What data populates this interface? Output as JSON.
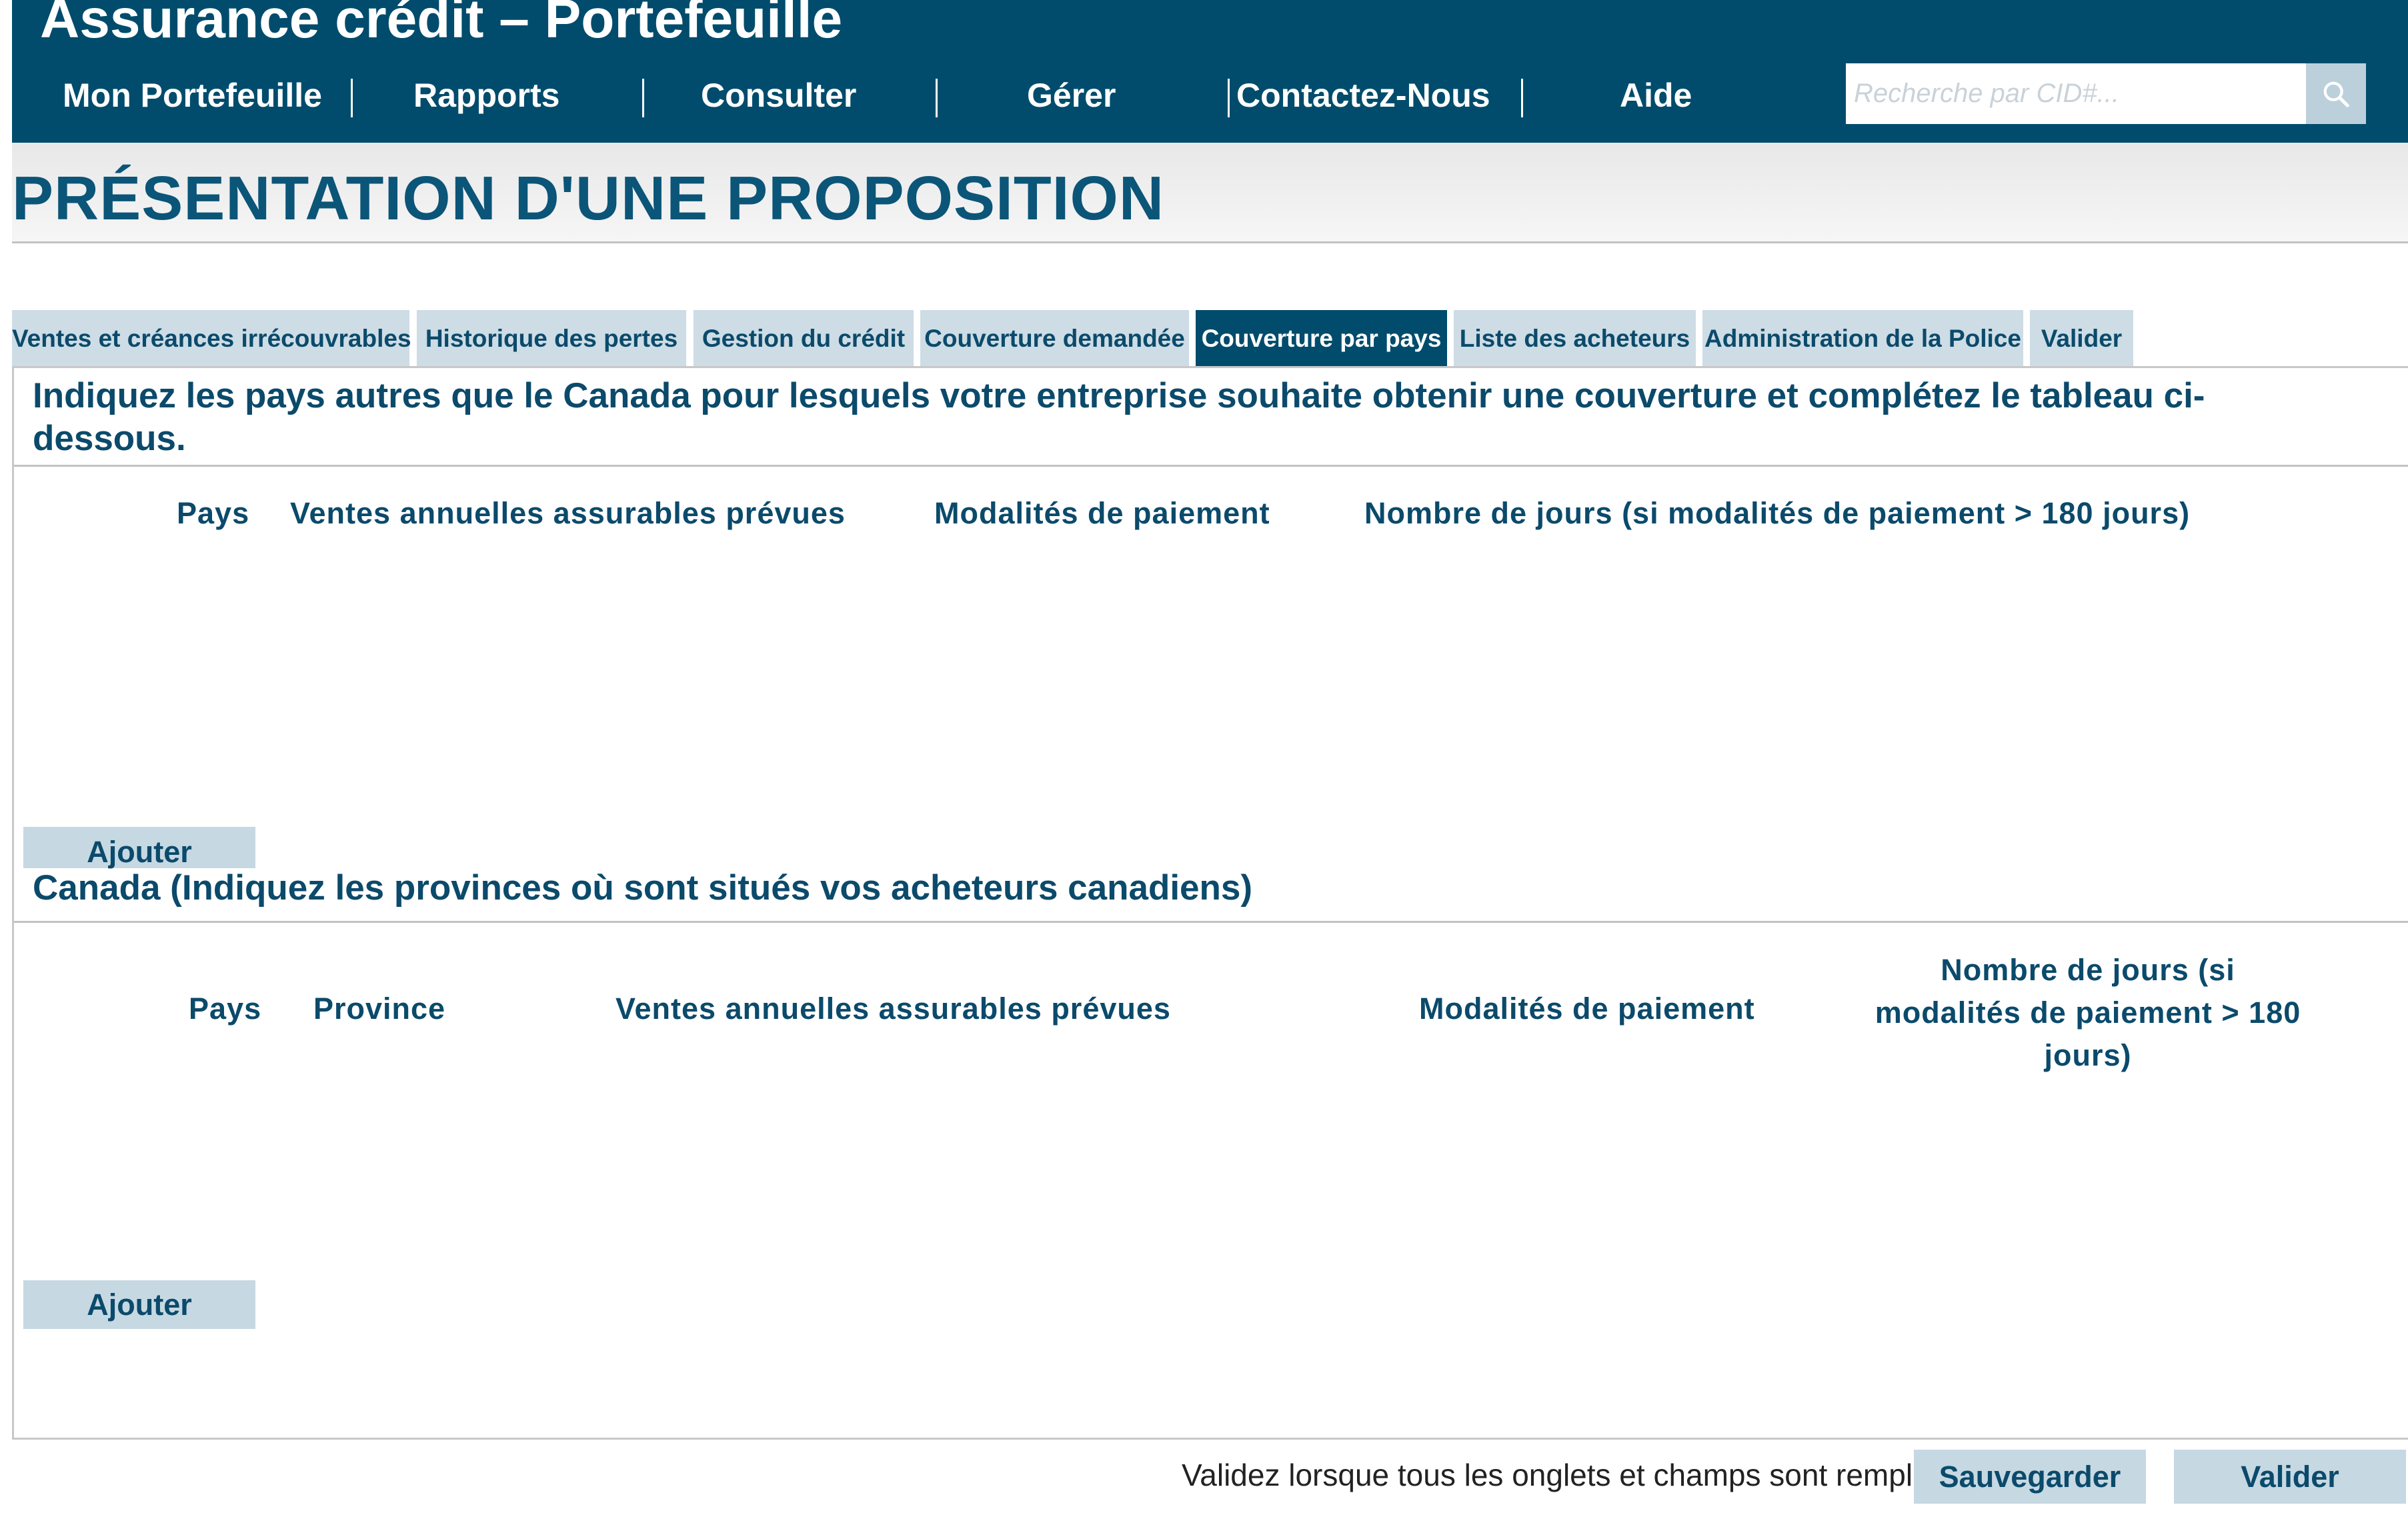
{
  "header": {
    "app_title": "Assurance crédit – Portefeuille",
    "nav": [
      "Mon Portefeuille",
      "Rapports",
      "Consulter",
      "Gérer",
      "Contactez-Nous",
      "Aide"
    ],
    "search": {
      "placeholder": "Recherche par CID#...",
      "value": "",
      "icon": "search-icon"
    }
  },
  "page": {
    "title": "PRÉSENTATION D'UNE PROPOSITION"
  },
  "tabs": [
    {
      "label": "Ventes et créances irrécouvrables",
      "active": false
    },
    {
      "label": "Historique des pertes",
      "active": false
    },
    {
      "label": "Gestion du crédit",
      "active": false
    },
    {
      "label": "Couverture demandée",
      "active": false
    },
    {
      "label": "Couverture par pays",
      "active": true
    },
    {
      "label": "Liste des acheteurs",
      "active": false
    },
    {
      "label": "Administration de la Police",
      "active": false
    },
    {
      "label": "Valider",
      "active": false
    }
  ],
  "foreign": {
    "instruction": "Indiquez les pays autres que le Canada pour lesquels votre entreprise souhaite obtenir une couverture et complétez le tableau ci-dessous.",
    "columns": [
      "Pays",
      "Ventes annuelles assurables prévues",
      "Modalités de paiement",
      "Nombre de jours (si modalités de paiement > 180 jours)"
    ],
    "add_label": "Ajouter"
  },
  "canada": {
    "instruction": "Canada (Indiquez les provinces où sont situés vos acheteurs canadiens)",
    "columns": [
      "Pays",
      "Province",
      "Ventes annuelles assurables prévues",
      "Modalités de paiement",
      "Nombre de jours (si modalités de paiement > 180 jours)"
    ],
    "add_label": "Ajouter"
  },
  "footer": {
    "note": "Validez lorsque tous les onglets et champs sont remplis",
    "save_label": "Sauvegarder",
    "validate_label": "Valider"
  },
  "colors": {
    "brand": "#014c6c",
    "tab_inactive": "#cddce5",
    "button": "#c6d8e2",
    "text": "#0b4a6b"
  }
}
